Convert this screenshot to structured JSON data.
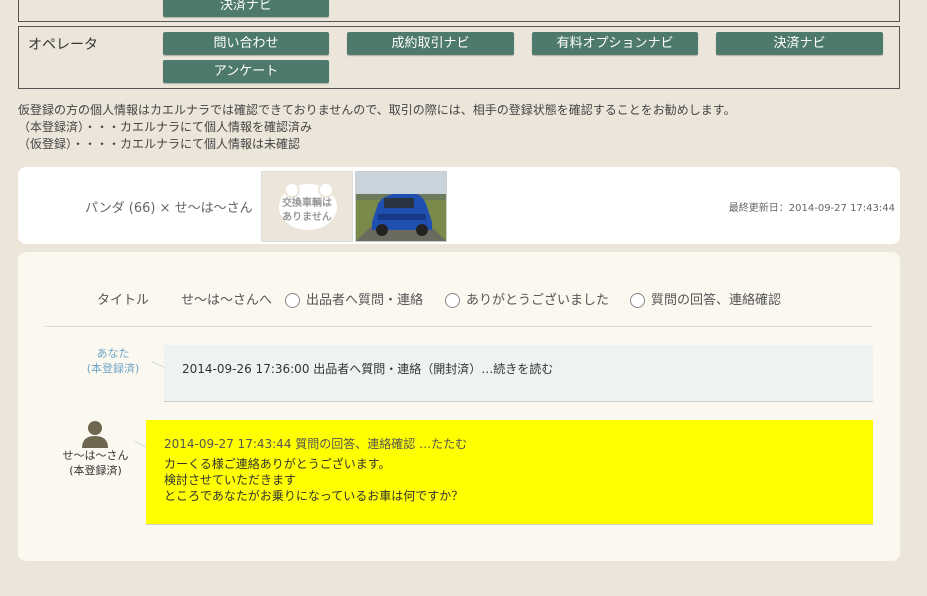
{
  "top_nav": {
    "partial_button": "決済ナビ",
    "operator_label": "オペレータ",
    "buttons": [
      "問い合わせ",
      "成約取引ナビ",
      "有料オプションナビ",
      "決済ナビ",
      "アンケート"
    ]
  },
  "notice": {
    "line1": "仮登録の方の個人情報はカエルナラでは確認できておりませんので、取引の際には、相手の登録状態を確認することをお勧めします。",
    "line2": "（本登録済）・・・カエルナラにて個人情報を確認済み",
    "line3": "（仮登録）・・・・カエルナラにて個人情報は未確認"
  },
  "listing": {
    "title": "パンダ (66) × せ〜は〜さん",
    "no_image_text_1": "交換車輌は",
    "no_image_text_2": "ありません",
    "updated": "最終更新日：2014-09-27 17:43:44"
  },
  "form": {
    "title_label": "タイトル",
    "recipient": "せ〜は〜さんへ",
    "options": [
      "出品者へ質問・連絡",
      "ありがとうございました",
      "質問の回答、連絡確認"
    ]
  },
  "messages": [
    {
      "sender_name": "あなた",
      "sender_status": "(本登録済)",
      "header": "2014-09-26 17:36:00 出品者へ質問・連絡（開封済）…続きを読む"
    },
    {
      "sender_name": "せ〜は〜さん",
      "sender_status": "(本登録済)",
      "header": "2014-09-27 17:43:44 質問の回答、連絡確認 …たたむ",
      "body": [
        "カーくる様ご連絡ありがとうございます。",
        "検討させていただきます",
        "ところであなたがお乗りになっているお車は何ですか？"
      ]
    }
  ],
  "colors": {
    "nav_button": "#4e7a6e",
    "highlight_message": "#ffff00",
    "page_bg": "#ece6da"
  }
}
